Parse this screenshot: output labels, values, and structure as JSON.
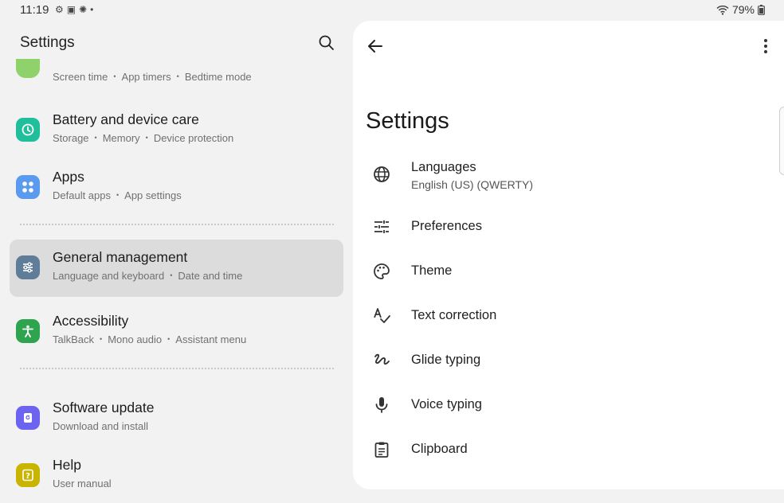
{
  "status": {
    "time": "11:19",
    "battery": "79%"
  },
  "left": {
    "title": "Settings",
    "partial_item": {
      "sub": [
        "Screen time",
        "App timers",
        "Bedtime mode"
      ]
    },
    "items": [
      {
        "title": "Battery and device care",
        "sub": [
          "Storage",
          "Memory",
          "Device protection"
        ],
        "color": "#1fbf9c"
      },
      {
        "title": "Apps",
        "sub": [
          "Default apps",
          "App settings"
        ],
        "color": "#5a9bf0"
      },
      {
        "title": "General management",
        "sub": [
          "Language and keyboard",
          "Date and time"
        ],
        "color": "#5f7d99"
      },
      {
        "title": "Accessibility",
        "sub": [
          "TalkBack",
          "Mono audio",
          "Assistant menu"
        ],
        "color": "#2ea44f"
      },
      {
        "title": "Software update",
        "sub": [
          "Download and install"
        ],
        "color": "#6c63f0"
      },
      {
        "title": "Help",
        "sub": [
          "User manual"
        ],
        "color": "#c9b400"
      }
    ]
  },
  "right": {
    "title": "Settings",
    "items": [
      {
        "label": "Languages",
        "sub": "English (US) (QWERTY)",
        "icon": "globe-icon"
      },
      {
        "label": "Preferences",
        "icon": "tune-icon"
      },
      {
        "label": "Theme",
        "icon": "palette-icon"
      },
      {
        "label": "Text correction",
        "icon": "spellcheck-icon"
      },
      {
        "label": "Glide typing",
        "icon": "gesture-icon"
      },
      {
        "label": "Voice typing",
        "icon": "mic-icon"
      },
      {
        "label": "Clipboard",
        "icon": "clipboard-icon"
      }
    ]
  }
}
